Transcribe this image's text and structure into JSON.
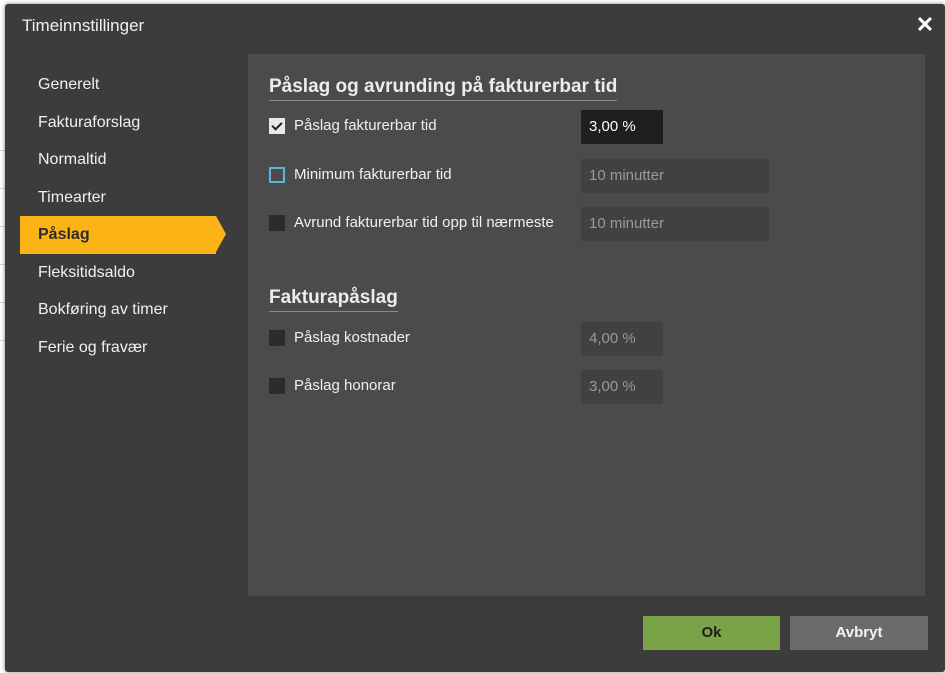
{
  "dialog": {
    "title": "Timeinnstillinger",
    "close_symbol": "✕"
  },
  "nav": {
    "items": [
      {
        "label": "Generelt",
        "active": false
      },
      {
        "label": "Fakturaforslag",
        "active": false
      },
      {
        "label": "Normaltid",
        "active": false
      },
      {
        "label": "Timearter",
        "active": false
      },
      {
        "label": "Påslag",
        "active": true
      },
      {
        "label": "Fleksitidsaldo",
        "active": false
      },
      {
        "label": "Bokføring av timer",
        "active": false
      },
      {
        "label": "Ferie og fravær",
        "active": false
      }
    ]
  },
  "section1": {
    "title": "Påslag og avrunding på fakturerbar tid",
    "rows": [
      {
        "label": "Påslag fakturerbar tid",
        "checked": true,
        "value": "3,00 %"
      },
      {
        "label": "Minimum fakturerbar tid",
        "checked": false,
        "value": "10 minutter"
      },
      {
        "label": "Avrund fakturerbar tid opp til nærmeste",
        "checked": false,
        "value": "10 minutter"
      }
    ]
  },
  "section2": {
    "title": "Fakturapåslag",
    "rows": [
      {
        "label": "Påslag kostnader",
        "checked": false,
        "value": "4,00 %"
      },
      {
        "label": "Påslag honorar",
        "checked": false,
        "value": "3,00 %"
      }
    ]
  },
  "buttons": {
    "ok": "Ok",
    "cancel": "Avbryt"
  },
  "colors": {
    "accent": "#fcb315",
    "ok_button": "#79a346",
    "cancel_button": "#6b6b6b",
    "dialog_bg": "#3c3c3c",
    "panel_bg": "#4b4b4b"
  }
}
